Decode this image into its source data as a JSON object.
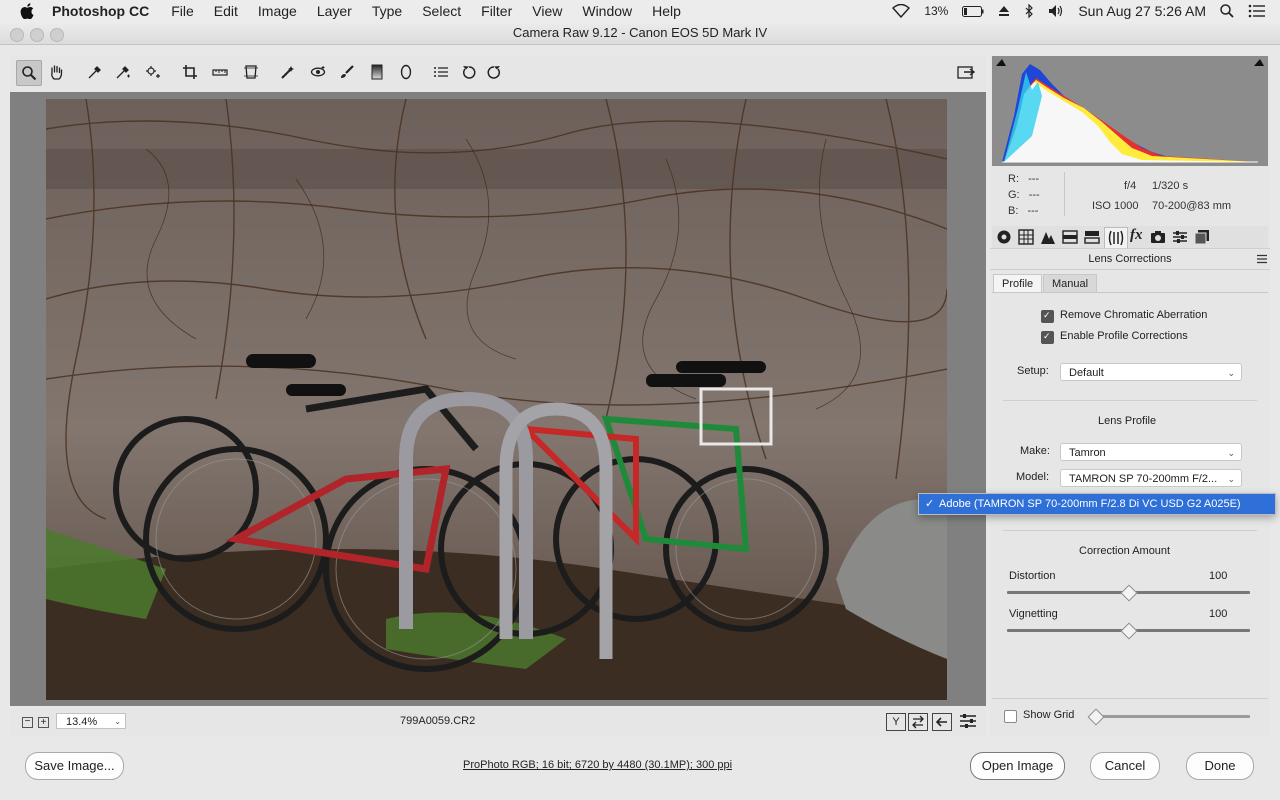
{
  "menubar": {
    "app_name": "Photoshop CC",
    "menus": [
      "File",
      "Edit",
      "Image",
      "Layer",
      "Type",
      "Select",
      "Filter",
      "View",
      "Window",
      "Help"
    ],
    "battery": "13%",
    "clock": "Sun Aug 27  5:26 AM"
  },
  "window": {
    "title": "Camera Raw 9.12  -  Canon EOS 5D Mark IV"
  },
  "toolbar": {
    "tools": [
      "zoom-tool",
      "hand-tool",
      "white-balance-tool",
      "color-sampler-tool",
      "targeted-adjustment-tool",
      "crop-tool",
      "straighten-tool",
      "transform-tool",
      "spot-removal-tool",
      "red-eye-tool",
      "adjustment-brush-tool",
      "graduated-filter-tool",
      "radial-filter-tool",
      "open-preferences",
      "rotate-ccw",
      "rotate-cw"
    ]
  },
  "bottombar": {
    "zoom": "13.4%",
    "filename": "799A0059.CR2"
  },
  "info": {
    "r_label": "R:",
    "r_val": "---",
    "g_label": "G:",
    "g_val": "---",
    "b_label": "B:",
    "b_val": "---",
    "aperture": "f/4",
    "shutter": "1/320 s",
    "iso": "ISO 1000",
    "lens": "70-200@83 mm"
  },
  "panel": {
    "title": "Lens Corrections",
    "tabs": [
      "Profile",
      "Manual"
    ],
    "active_tab": "Profile",
    "remove_ca": "Remove Chromatic Aberration",
    "enable_profile": "Enable Profile Corrections",
    "setup_label": "Setup:",
    "setup_value": "Default",
    "lens_profile_heading": "Lens Profile",
    "make_label": "Make:",
    "make_value": "Tamron",
    "model_label": "Model:",
    "model_value": "TAMRON SP 70-200mm F/2...",
    "correction_heading": "Correction Amount",
    "distortion_label": "Distortion",
    "distortion_value": "100",
    "distortion_level": 0.5,
    "vignetting_label": "Vignetting",
    "vignetting_value": "100",
    "vignetting_level": 0.5,
    "show_grid": "Show Grid"
  },
  "popup": {
    "selected_item": "Adobe (TAMRON SP 70-200mm F/2.8 Di VC USD G2 A025E)"
  },
  "footer": {
    "save_label": "Save Image...",
    "workflow_link": "ProPhoto RGB; 16 bit; 6720 by 4480 (30.1MP); 300 ppi",
    "open_label": "Open Image",
    "cancel_label": "Cancel",
    "done_label": "Done"
  }
}
